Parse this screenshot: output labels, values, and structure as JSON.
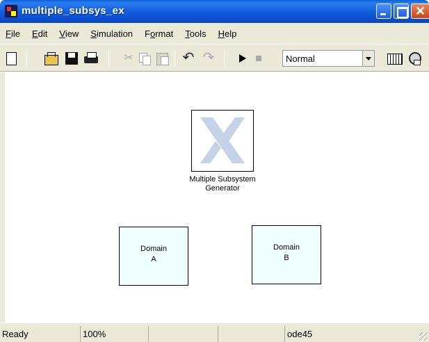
{
  "window": {
    "title": "multiple_subsys_ex",
    "controls": [
      "minimize",
      "maximize",
      "close"
    ]
  },
  "menu": [
    {
      "u": "F",
      "rest": "ile"
    },
    {
      "u": "E",
      "rest": "dit"
    },
    {
      "u": "V",
      "rest": "iew"
    },
    {
      "u": "S",
      "rest": "imulation"
    },
    {
      "pre": "F",
      "u": "o",
      "rest": "rmat"
    },
    {
      "u": "T",
      "rest": "ools"
    },
    {
      "u": "H",
      "rest": "elp"
    }
  ],
  "toolbar": {
    "icons": [
      "new-file-icon",
      "open-folder-icon",
      "save-icon",
      "print-icon",
      "cut-icon",
      "copy-icon",
      "paste-icon",
      "undo-icon",
      "redo-icon",
      "start-simulation-icon",
      "stop-simulation-icon",
      "library-browser-icon",
      "model-explorer-icon"
    ],
    "simulation_mode": "Normal"
  },
  "diagram": {
    "generator_block": {
      "line1": "Multiple Subsystem",
      "line2": "Generator",
      "logo": "xilinx-logo-icon",
      "logo_color": "#c5d3e8"
    },
    "domain_a": {
      "line1": "Domain",
      "line2": "A"
    },
    "domain_b": {
      "line1": "Domain",
      "line2": "B"
    },
    "domain_fill": "#efffff"
  },
  "status": {
    "state": "Ready",
    "zoom": "100%",
    "pane3": "",
    "pane4": "",
    "solver": "ode45"
  },
  "colors": {
    "titlebar": "#0b4fd0",
    "chrome": "#ece9d8",
    "close_button": "#c8431a"
  }
}
